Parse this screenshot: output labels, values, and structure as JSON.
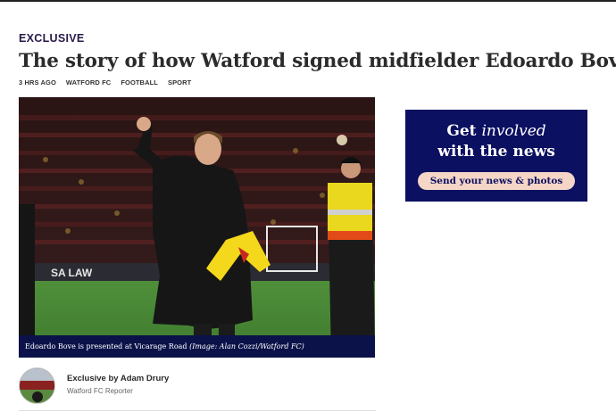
{
  "article": {
    "kicker": "EXCLUSIVE",
    "headline": "The story of how Watford signed midfielder Edoardo Bove",
    "meta": {
      "time": "3 HRS AGO",
      "tags": [
        "WATFORD FC",
        "FOOTBALL",
        "SPORT"
      ]
    },
    "image": {
      "caption": "Edoardo Bove is presented at Vicarage Road",
      "credit": "(Image: Alan Cozzi/Watford FC)",
      "hoarding_text": "SA LAW"
    },
    "author": {
      "byline": "Exclusive by Adam Drury",
      "role": "Watford FC Reporter"
    }
  },
  "promo": {
    "title_line1_a": "Get ",
    "title_line1_b": "involved",
    "title_line2": "with the news",
    "button_label": "Send your news & photos"
  },
  "colors": {
    "navy": "#0b1061",
    "caption_bar": "#0b1249",
    "button_bg": "#f5d5c6"
  }
}
